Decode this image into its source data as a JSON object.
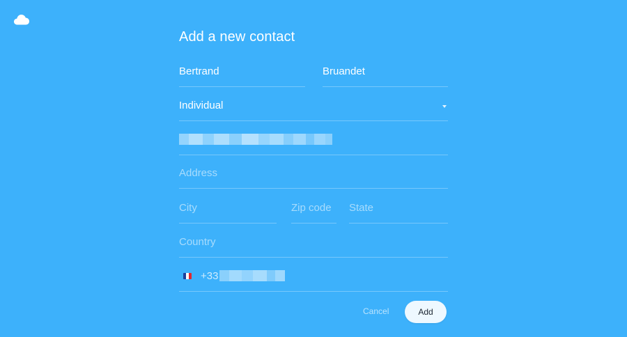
{
  "title": "Add a new contact",
  "first_name": {
    "value": "Bertrand"
  },
  "last_name": {
    "value": "Bruandet"
  },
  "contact_type": {
    "selected": "Individual"
  },
  "address": {
    "placeholder": "Address"
  },
  "city": {
    "placeholder": "City"
  },
  "zip": {
    "placeholder": "Zip code"
  },
  "state": {
    "placeholder": "State"
  },
  "country": {
    "placeholder": "Country"
  },
  "phone": {
    "prefix": "+33",
    "country_flag": "france-flag"
  },
  "actions": {
    "cancel_label": "Cancel",
    "add_label": "Add"
  },
  "colors": {
    "background": "#3db1fb",
    "button_bg": "#eef8ff",
    "button_text": "#1a2430"
  },
  "icons": {
    "logo": "cloud-icon",
    "select": "chevron-down-icon"
  }
}
